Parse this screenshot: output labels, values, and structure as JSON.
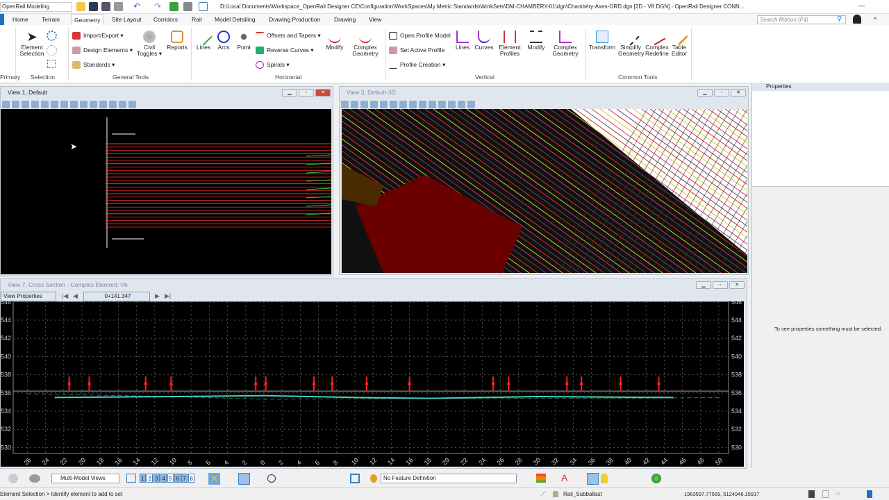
{
  "titlebar": {
    "workspace": "OpenRail Modeling",
    "document_title": "D:\\Local Documents\\Workspace_OpenRail Designer CE\\Configuration\\WorkSpaces\\My Metric Standards\\WorkSets\\DM-CHAMBERY-01\\dgn\\Chambéry-Axes-ORD.dgn [2D - V8 DGN] - OpenRail Designer CONN..."
  },
  "ribbon": {
    "tabs": [
      "Home",
      "Terrain",
      "Geometry",
      "Site Layout",
      "Corridors",
      "Rail",
      "Model Detailing",
      "Drawing Production",
      "Drawing",
      "View"
    ],
    "active_tab": "Geometry",
    "search_placeholder": "Search Ribbon (F4)",
    "groups": {
      "primary": "Primary",
      "selection": "Selection",
      "general_tools": "General Tools",
      "horizontal": "Horizontal",
      "vertical": "Vertical",
      "common_tools": "Common Tools"
    },
    "selection": {
      "element_selection": "Element Selection"
    },
    "general_tools": {
      "import_export": "Import/Export",
      "design_elements": "Design Elements",
      "standards": "Standards",
      "civil_toggles": "Civil Toggles",
      "reports": "Reports"
    },
    "horizontal": {
      "lines": "Lines",
      "arcs": "Arcs",
      "point": "Point",
      "offsets_tapers": "Offsets and Tapers",
      "reverse_curves": "Reverse Curves",
      "spirals": "Spirals",
      "modify": "Modify",
      "complex_geometry": "Complex Geometry"
    },
    "vertical": {
      "open_profile_model": "Open Profile Model",
      "set_active_profile": "Set Active Profile",
      "profile_creation": "Profile Creation",
      "lines": "Lines",
      "curves": "Curves",
      "element_profiles": "Element Profiles",
      "modify": "Modify",
      "complex_geometry": "Complex Geometry"
    },
    "common_tools": {
      "transform": "Transform",
      "simplify_geometry": "Simplify Geometry",
      "complex_redefine": "Complex Redefine",
      "table_editor": "Table Editor"
    }
  },
  "views": {
    "view1": {
      "title": "View 1, Default"
    },
    "view3": {
      "title": "View 3, Default-3D"
    },
    "view7": {
      "title": "View 7, Cross Section - Complex Element: V6",
      "view_properties": "View Properties",
      "station": "0+141.347"
    }
  },
  "cross_section": {
    "y_ticks": [
      546,
      544,
      542,
      540,
      538,
      536,
      534,
      532,
      530
    ],
    "x_ticks": [
      -26,
      -24,
      -22,
      -20,
      -18,
      -16,
      -14,
      -12,
      -10,
      -8,
      -6,
      -4,
      -2,
      0,
      2,
      4,
      6,
      8,
      10,
      12,
      14,
      16,
      18,
      20,
      22,
      24,
      26,
      28,
      30,
      32,
      34,
      36,
      38,
      40,
      42,
      44,
      46,
      48,
      50
    ],
    "rail_markers_x": [
      -21.4,
      -19.2,
      -13,
      -10.2,
      -0.9,
      0.2,
      5.5,
      7.5,
      11.3,
      16,
      25.2,
      26.9,
      33.3,
      34.9,
      39.2,
      43.4
    ],
    "rail_marker_range": [
      536.2,
      537.8
    ],
    "ground_level": 536.2,
    "colors": {
      "marker": "#ff2020",
      "ground": "#40d0d0",
      "grid": "#555555"
    }
  },
  "properties": {
    "title": "Properties",
    "empty_message": "To see properties something must be selected."
  },
  "bottom_toolbar": {
    "view_group": "Multi-Model Views",
    "view_numbers": [
      "1",
      "2",
      "3",
      "4",
      "5",
      "6",
      "7",
      "8"
    ],
    "feature_definition": "No Feature Definition"
  },
  "status": {
    "prompt": "Element Selection > Identify element to add to set",
    "level": "Rail_Subballast",
    "coordinates": "1963597.77569, 5124946.15917"
  }
}
